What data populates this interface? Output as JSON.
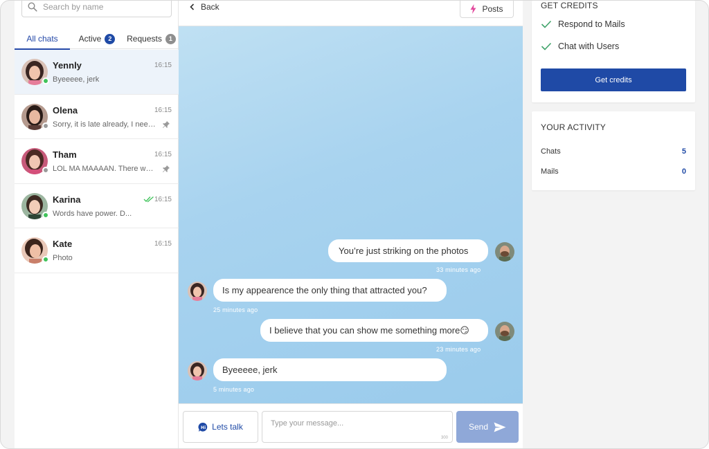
{
  "search": {
    "placeholder": "Search by name"
  },
  "tabs": [
    {
      "label": "All chats"
    },
    {
      "label": "Active",
      "badge": "2"
    },
    {
      "label": "Requests",
      "badge": "1"
    }
  ],
  "chats": [
    {
      "name": "Yennly",
      "time": "16:15",
      "preview": "Byeeeee, jerk",
      "online": true
    },
    {
      "name": "Olena",
      "time": "16:15",
      "preview": "Sorry, it is late already, I need to go",
      "online": false,
      "pinned": true
    },
    {
      "name": "Tham",
      "time": "16:15",
      "preview": "LOL MA MAAAAN. There was something",
      "online": false,
      "pinned": true
    },
    {
      "name": "Karina",
      "time": "16:15",
      "preview": "Words have power. D...",
      "online": true,
      "read": true
    },
    {
      "name": "Kate",
      "time": "16:15",
      "preview": "Photo",
      "online": true
    }
  ],
  "conversation": {
    "back_label": "Back",
    "posts_label": "Posts",
    "messages": [
      {
        "from": "me",
        "text": "You’re just striking on the photos",
        "time": "33 minutes ago"
      },
      {
        "from": "her",
        "text": "Is my appearence the only thing that attracted you?",
        "time": "25 minutes ago"
      },
      {
        "from": "me",
        "text": "I believe that you can show me something more😏",
        "time": "23 minutes ago"
      },
      {
        "from": "her",
        "text": "Byeeeee, jerk",
        "time": "5 minutes ago"
      }
    ]
  },
  "composer": {
    "lets_talk_label": "Lets talk",
    "lets_talk_icon_text": "Hi",
    "placeholder": "Type your message...",
    "char_limit": "300",
    "send_label": "Send"
  },
  "credits": {
    "title": "GET CREDITS",
    "items": [
      "Respond to Mails",
      "Chat with Users"
    ],
    "button_label": "Get credits"
  },
  "activity": {
    "title": "YOUR ACTIVITY",
    "rows": [
      {
        "label": "Chats",
        "value": "5"
      },
      {
        "label": "Mails",
        "value": "0"
      }
    ]
  },
  "colors": {
    "accent": "#1f4aa6",
    "online": "#3fc35a",
    "offline": "#9a9a9a",
    "send_disabled": "#8fa8d8"
  }
}
